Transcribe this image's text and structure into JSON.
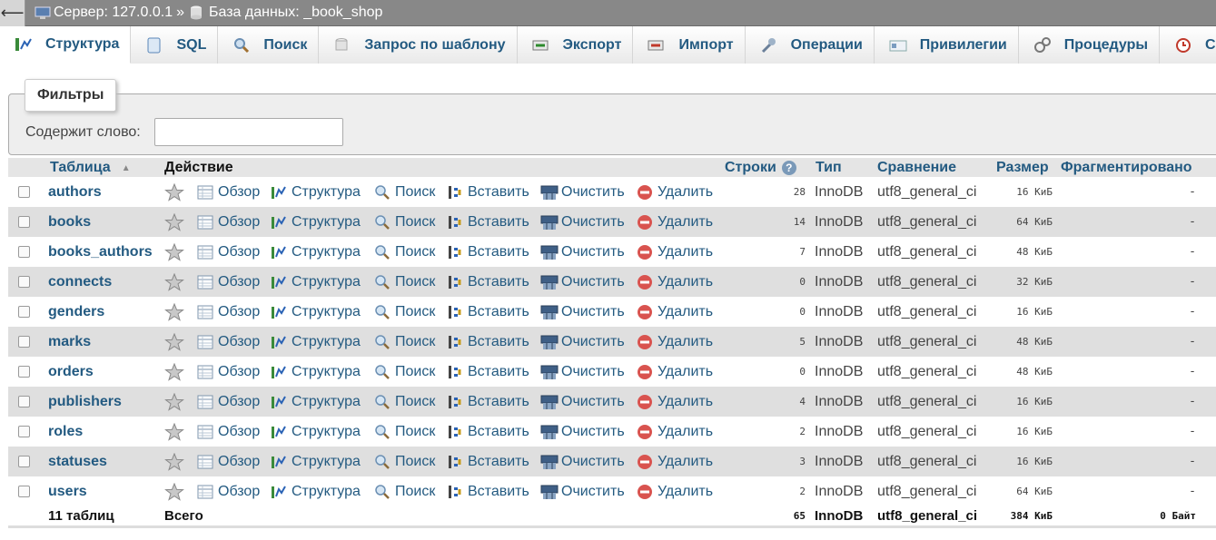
{
  "breadcrumb": {
    "server": "Сервер: 127.0.0.1",
    "separator": "»",
    "database": "База данных: _book_shop"
  },
  "tabs": [
    {
      "label": "Структура",
      "icon": "structure-icon",
      "active": true
    },
    {
      "label": "SQL",
      "icon": "sql-icon"
    },
    {
      "label": "Поиск",
      "icon": "search-icon"
    },
    {
      "label": "Запрос по шаблону",
      "icon": "query-icon"
    },
    {
      "label": "Экспорт",
      "icon": "export-icon"
    },
    {
      "label": "Импорт",
      "icon": "import-icon"
    },
    {
      "label": "Операции",
      "icon": "wrench-icon"
    },
    {
      "label": "Привилегии",
      "icon": "privileges-icon"
    },
    {
      "label": "Процедуры",
      "icon": "routines-icon"
    },
    {
      "label": "Со",
      "icon": "events-icon"
    }
  ],
  "filters": {
    "legend": "Фильтры",
    "label": "Содержит слово:",
    "value": ""
  },
  "table": {
    "headers": {
      "table": "Таблица",
      "sort_indicator": "▲",
      "action": "Действие",
      "rows": "Строки",
      "type": "Тип",
      "collation": "Сравнение",
      "size": "Размер",
      "overhead": "Фрагментировано"
    },
    "actions": {
      "browse": "Обзор",
      "structure": "Структура",
      "search": "Поиск",
      "insert": "Вставить",
      "empty": "Очистить",
      "drop": "Удалить"
    },
    "rows": [
      {
        "name": "authors",
        "rows": "28",
        "type": "InnoDB",
        "collation": "utf8_general_ci",
        "size": "16 КиБ",
        "overhead": "-"
      },
      {
        "name": "books",
        "rows": "14",
        "type": "InnoDB",
        "collation": "utf8_general_ci",
        "size": "64 КиБ",
        "overhead": "-"
      },
      {
        "name": "books_authors",
        "rows": "7",
        "type": "InnoDB",
        "collation": "utf8_general_ci",
        "size": "48 КиБ",
        "overhead": "-"
      },
      {
        "name": "connects",
        "rows": "0",
        "type": "InnoDB",
        "collation": "utf8_general_ci",
        "size": "32 КиБ",
        "overhead": "-"
      },
      {
        "name": "genders",
        "rows": "0",
        "type": "InnoDB",
        "collation": "utf8_general_ci",
        "size": "16 КиБ",
        "overhead": "-"
      },
      {
        "name": "marks",
        "rows": "5",
        "type": "InnoDB",
        "collation": "utf8_general_ci",
        "size": "48 КиБ",
        "overhead": "-"
      },
      {
        "name": "orders",
        "rows": "0",
        "type": "InnoDB",
        "collation": "utf8_general_ci",
        "size": "48 КиБ",
        "overhead": "-"
      },
      {
        "name": "publishers",
        "rows": "4",
        "type": "InnoDB",
        "collation": "utf8_general_ci",
        "size": "16 КиБ",
        "overhead": "-"
      },
      {
        "name": "roles",
        "rows": "2",
        "type": "InnoDB",
        "collation": "utf8_general_ci",
        "size": "16 КиБ",
        "overhead": "-"
      },
      {
        "name": "statuses",
        "rows": "3",
        "type": "InnoDB",
        "collation": "utf8_general_ci",
        "size": "16 КиБ",
        "overhead": "-"
      },
      {
        "name": "users",
        "rows": "2",
        "type": "InnoDB",
        "collation": "utf8_general_ci",
        "size": "64 КиБ",
        "overhead": "-"
      }
    ],
    "footer": {
      "count": "11 таблиц",
      "label": "Всего",
      "rows": "65",
      "type": "InnoDB",
      "collation": "utf8_general_ci",
      "size": "384 КиБ",
      "overhead": "0 Байт"
    }
  },
  "colors": {
    "link": "#235a81",
    "topbar": "#888888",
    "row_alt": "#dfdfdf",
    "drop": "#d9534f"
  }
}
